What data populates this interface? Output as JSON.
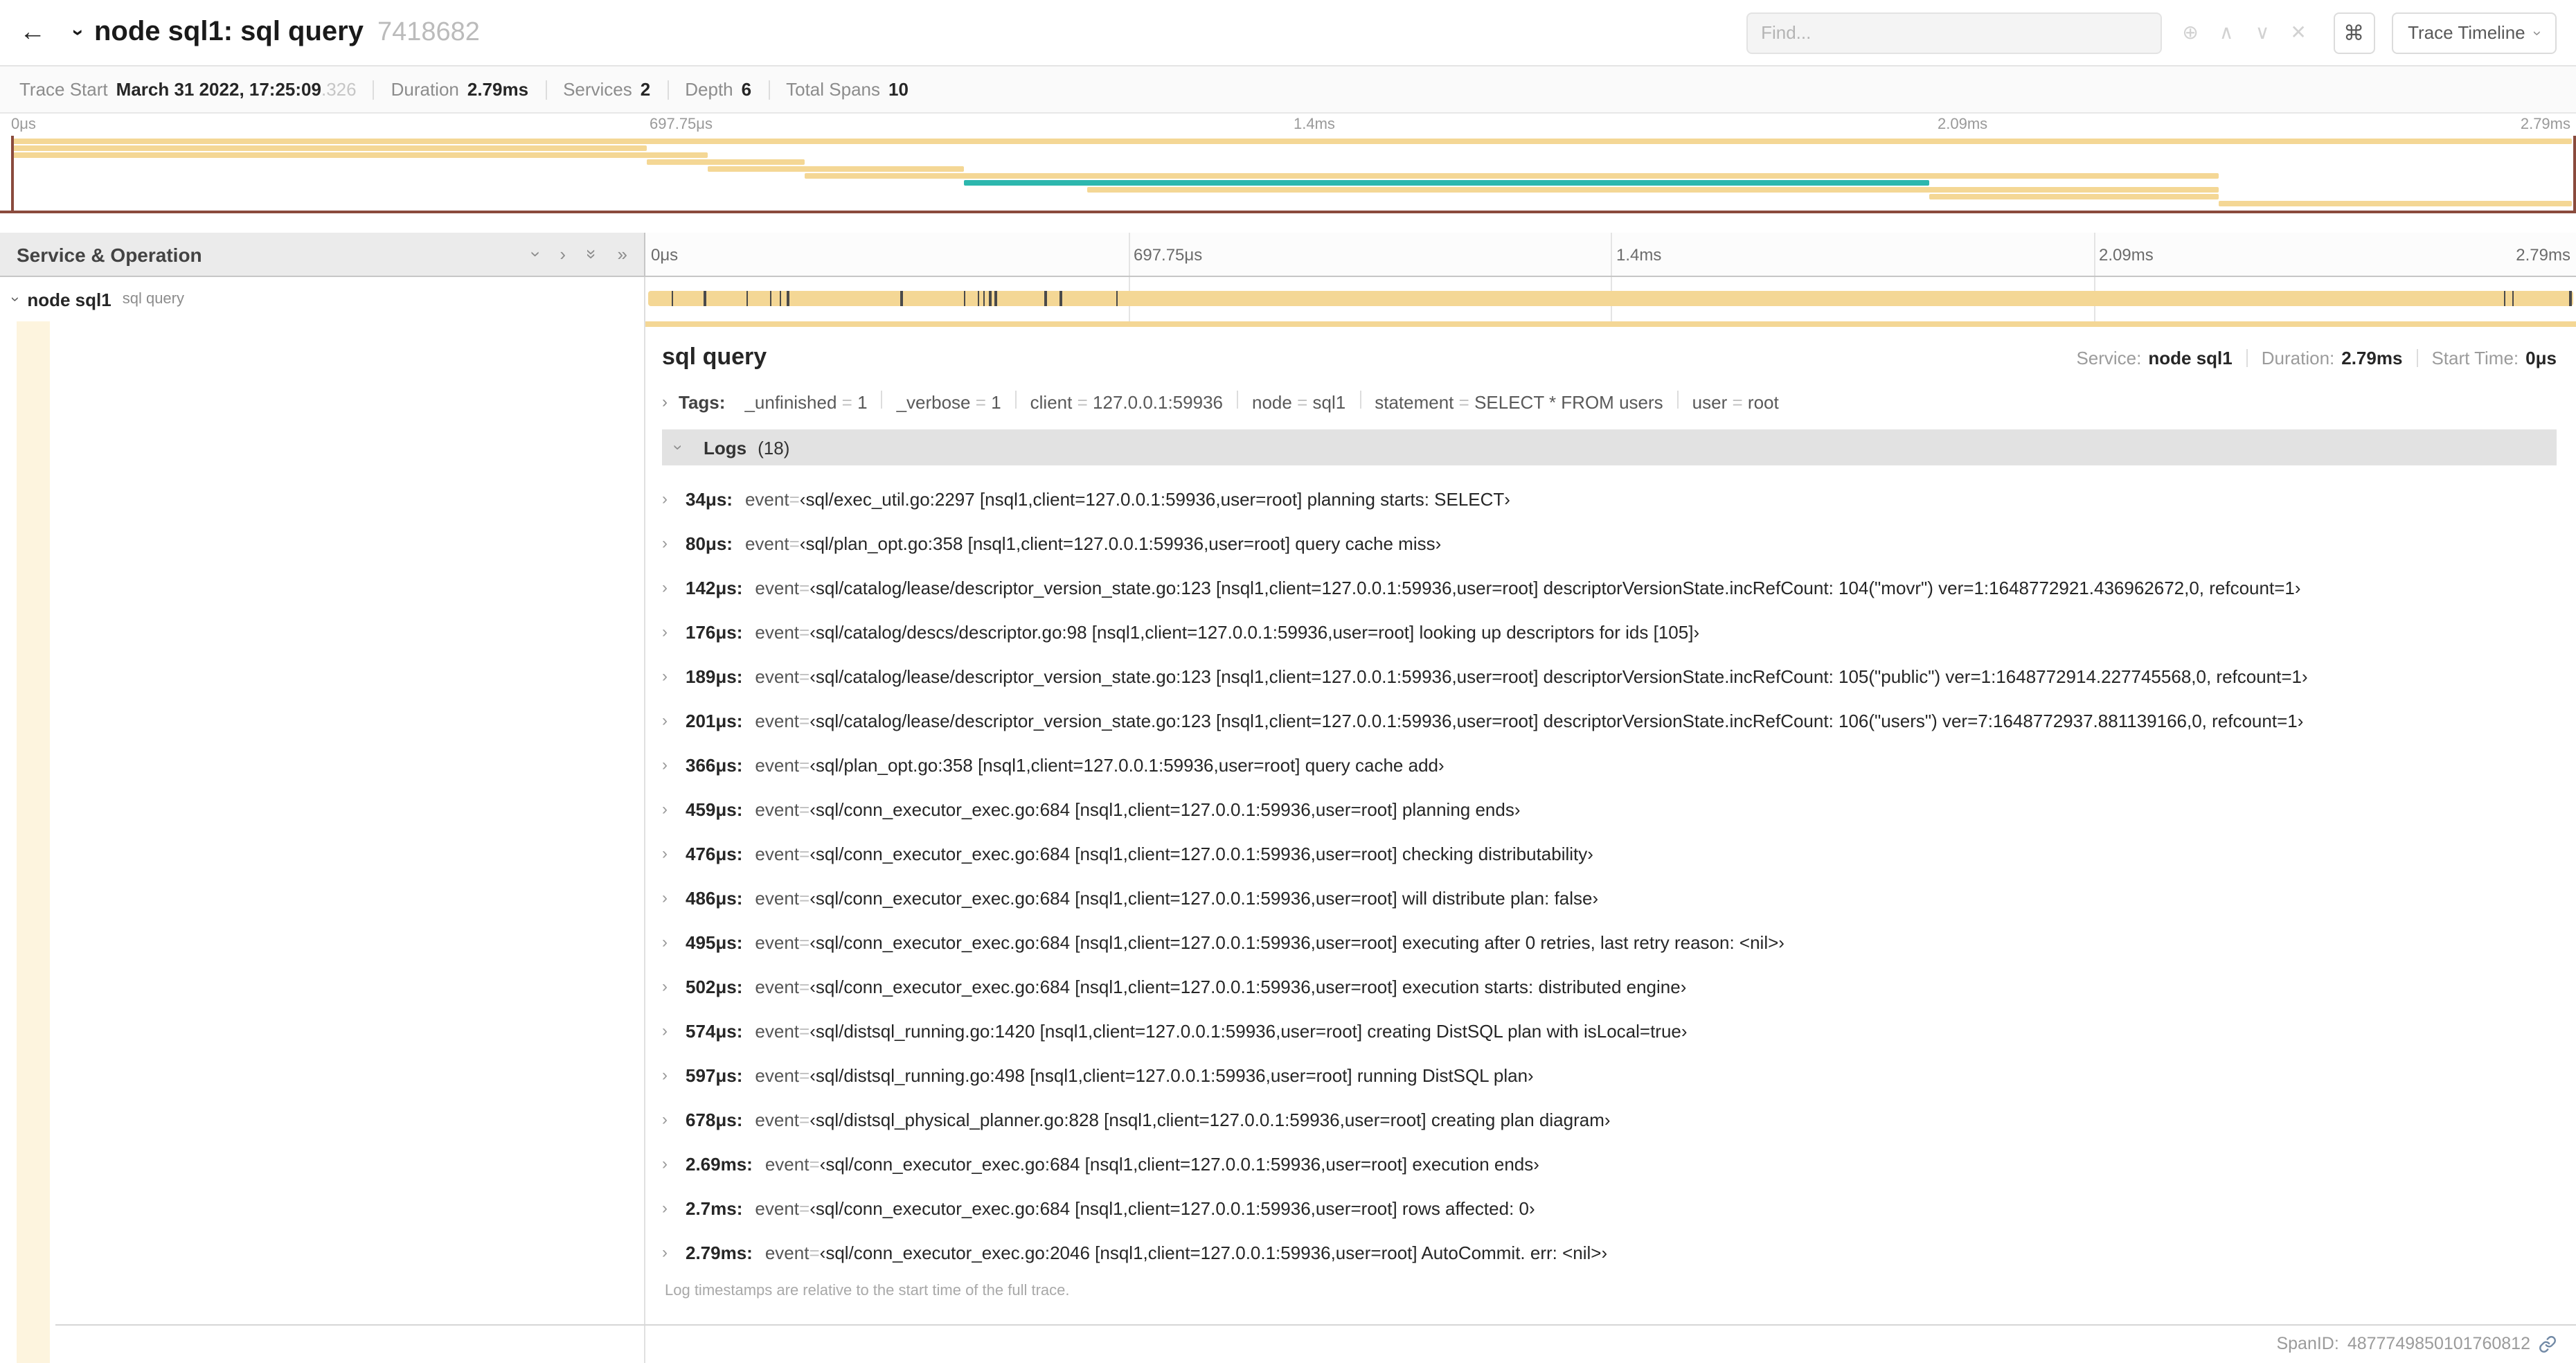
{
  "icons": {
    "back": "←",
    "chevron_right": "›",
    "double_chevron_right": "»",
    "circle_plus": "⊕",
    "up": "∧",
    "down": "∨",
    "close": "✕",
    "command": "⌘"
  },
  "header": {
    "title": "node sql1: sql query",
    "trace_id": "7418682",
    "find_placeholder": "Find...",
    "view_select": "Trace Timeline"
  },
  "summary": {
    "items": [
      {
        "label": "Trace Start",
        "value": "March 31 2022, 17:25:09",
        "muted": ".326"
      },
      {
        "label": "Duration",
        "value": "2.79ms"
      },
      {
        "label": "Services",
        "value": "2"
      },
      {
        "label": "Depth",
        "value": "6"
      },
      {
        "label": "Total Spans",
        "value": "10"
      }
    ]
  },
  "minimap": {
    "ticks": [
      "0μs",
      "697.75μs",
      "1.4ms",
      "2.09ms",
      "2.79ms"
    ],
    "colors": {
      "tan": "#f4d795",
      "teal": "#2db7ae",
      "scrubber": "#8a4b3d"
    },
    "spans": [
      {
        "row": 0,
        "start": 0,
        "end": 100,
        "color": "tan"
      },
      {
        "row": 1,
        "start": 0,
        "end": 24.8,
        "color": "tan"
      },
      {
        "row": 2,
        "start": 0,
        "end": 27.2,
        "color": "tan"
      },
      {
        "row": 3,
        "start": 24.8,
        "end": 31,
        "color": "tan"
      },
      {
        "row": 4,
        "start": 27.2,
        "end": 37.2,
        "color": "tan"
      },
      {
        "row": 5,
        "start": 31,
        "end": 86.2,
        "color": "tan"
      },
      {
        "row": 6,
        "start": 37.2,
        "end": 74.9,
        "color": "teal"
      },
      {
        "row": 7,
        "start": 42,
        "end": 86.2,
        "color": "tan"
      },
      {
        "row": 8,
        "start": 74.9,
        "end": 86.2,
        "color": "tan"
      },
      {
        "row": 9,
        "start": 86.2,
        "end": 100,
        "color": "tan"
      }
    ]
  },
  "timeline": {
    "left_header": "Service & Operation",
    "ticks": [
      "0μs",
      "697.75μs",
      "1.4ms",
      "2.09ms",
      "2.79ms"
    ],
    "row": {
      "service": "node sql1",
      "operation": "sql query",
      "log_marker_pcts": [
        1.2,
        2.9,
        5.1,
        6.3,
        6.8,
        7.2,
        13.1,
        16.4,
        17.1,
        17.4,
        17.7,
        18.0,
        20.6,
        21.4,
        24.3,
        96.4,
        96.8,
        99.8
      ]
    }
  },
  "detail": {
    "title": "sql query",
    "meta": [
      {
        "label": "Service:",
        "value": "node sql1"
      },
      {
        "label": "Duration:",
        "value": "2.79ms"
      },
      {
        "label": "Start Time:",
        "value": "0μs"
      }
    ],
    "tags_label": "Tags:",
    "tags": [
      {
        "key": "_unfinished",
        "value": "1"
      },
      {
        "key": "_verbose",
        "value": "1"
      },
      {
        "key": "client",
        "value": "127.0.0.1:59936"
      },
      {
        "key": "node",
        "value": "sql1"
      },
      {
        "key": "statement",
        "value": "SELECT * FROM users"
      },
      {
        "key": "user",
        "value": "root"
      }
    ],
    "logs_title": "Logs",
    "logs_count": "(18)",
    "logs": [
      {
        "ts": "34μs:",
        "key": "event",
        "value": "‹sql/exec_util.go:2297 [nsql1,client=127.0.0.1:59936,user=root] planning starts: SELECT›"
      },
      {
        "ts": "80μs:",
        "key": "event",
        "value": "‹sql/plan_opt.go:358 [nsql1,client=127.0.0.1:59936,user=root] query cache miss›"
      },
      {
        "ts": "142μs:",
        "key": "event",
        "value": "‹sql/catalog/lease/descriptor_version_state.go:123 [nsql1,client=127.0.0.1:59936,user=root] descriptorVersionState.incRefCount: 104(\"movr\") ver=1:1648772921.436962672,0, refcount=1›"
      },
      {
        "ts": "176μs:",
        "key": "event",
        "value": "‹sql/catalog/descs/descriptor.go:98 [nsql1,client=127.0.0.1:59936,user=root] looking up descriptors for ids [105]›"
      },
      {
        "ts": "189μs:",
        "key": "event",
        "value": "‹sql/catalog/lease/descriptor_version_state.go:123 [nsql1,client=127.0.0.1:59936,user=root] descriptorVersionState.incRefCount: 105(\"public\") ver=1:1648772914.227745568,0, refcount=1›"
      },
      {
        "ts": "201μs:",
        "key": "event",
        "value": "‹sql/catalog/lease/descriptor_version_state.go:123 [nsql1,client=127.0.0.1:59936,user=root] descriptorVersionState.incRefCount: 106(\"users\") ver=7:1648772937.881139166,0, refcount=1›"
      },
      {
        "ts": "366μs:",
        "key": "event",
        "value": "‹sql/plan_opt.go:358 [nsql1,client=127.0.0.1:59936,user=root] query cache add›"
      },
      {
        "ts": "459μs:",
        "key": "event",
        "value": "‹sql/conn_executor_exec.go:684 [nsql1,client=127.0.0.1:59936,user=root] planning ends›"
      },
      {
        "ts": "476μs:",
        "key": "event",
        "value": "‹sql/conn_executor_exec.go:684 [nsql1,client=127.0.0.1:59936,user=root] checking distributability›"
      },
      {
        "ts": "486μs:",
        "key": "event",
        "value": "‹sql/conn_executor_exec.go:684 [nsql1,client=127.0.0.1:59936,user=root] will distribute plan: false›"
      },
      {
        "ts": "495μs:",
        "key": "event",
        "value": "‹sql/conn_executor_exec.go:684 [nsql1,client=127.0.0.1:59936,user=root] executing after 0 retries, last retry reason: <nil>›"
      },
      {
        "ts": "502μs:",
        "key": "event",
        "value": "‹sql/conn_executor_exec.go:684 [nsql1,client=127.0.0.1:59936,user=root] execution starts: distributed engine›"
      },
      {
        "ts": "574μs:",
        "key": "event",
        "value": "‹sql/distsql_running.go:1420 [nsql1,client=127.0.0.1:59936,user=root] creating DistSQL plan with isLocal=true›"
      },
      {
        "ts": "597μs:",
        "key": "event",
        "value": "‹sql/distsql_running.go:498 [nsql1,client=127.0.0.1:59936,user=root] running DistSQL plan›"
      },
      {
        "ts": "678μs:",
        "key": "event",
        "value": "‹sql/distsql_physical_planner.go:828 [nsql1,client=127.0.0.1:59936,user=root] creating plan diagram›"
      },
      {
        "ts": "2.69ms:",
        "key": "event",
        "value": "‹sql/conn_executor_exec.go:684 [nsql1,client=127.0.0.1:59936,user=root] execution ends›"
      },
      {
        "ts": "2.7ms:",
        "key": "event",
        "value": "‹sql/conn_executor_exec.go:684 [nsql1,client=127.0.0.1:59936,user=root] rows affected: 0›"
      },
      {
        "ts": "2.79ms:",
        "key": "event",
        "value": "‹sql/conn_executor_exec.go:2046 [nsql1,client=127.0.0.1:59936,user=root] AutoCommit. err: <nil>›"
      }
    ],
    "footnote": "Log timestamps are relative to the start time of the full trace.",
    "span_id_label": "SpanID:",
    "span_id": "4877749850101760812"
  }
}
